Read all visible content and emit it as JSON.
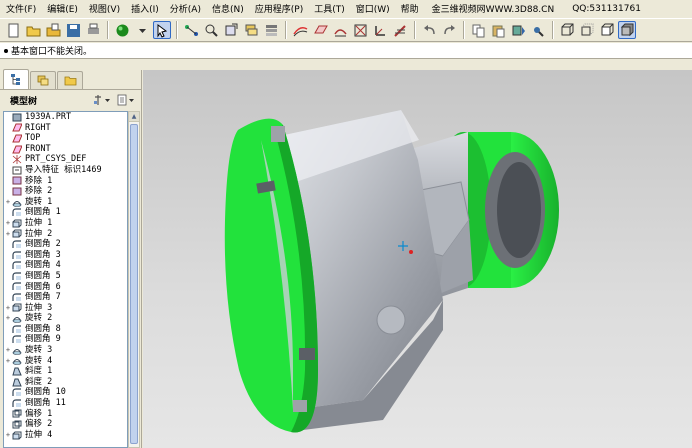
{
  "menubar": {
    "items": [
      "文件(F)",
      "编辑(E)",
      "视图(V)",
      "插入(I)",
      "分析(A)",
      "信息(N)",
      "应用程序(P)",
      "工具(T)",
      "窗口(W)",
      "帮助"
    ],
    "extra_text": "金三维视频网WWW.3D88.CN",
    "qq_text": "QQ:531131761"
  },
  "toolbar": {
    "icons": [
      "new-file-icon",
      "open-folder-icon",
      "open-file-icon",
      "save-icon",
      "print-icon",
      "color-sphere-icon",
      "dropdown-arrow-icon",
      "select-icon",
      "relations-icon",
      "zoom-window-icon",
      "reorient-icon",
      "layers-icon",
      "saved-views-icon",
      "surface-icon",
      "datum-plane-icon",
      "datum-axis-icon",
      "datum-point-icon",
      "coordinate-icon",
      "sketch-icon",
      "undo-icon",
      "redo-icon",
      "copy-icon",
      "paste-icon",
      "regenerate-icon",
      "find-icon",
      "wireframe-icon",
      "hidden-line-icon",
      "no-hidden-icon",
      "shading-icon"
    ]
  },
  "message": "基本窗口不能关闭。",
  "sidebar": {
    "tabs": [
      "model-tree-tab",
      "layers-tab",
      "folder-tab"
    ],
    "tree_title": "模型树",
    "tree": [
      {
        "label": "1939A.PRT",
        "icon": "part",
        "expand": ""
      },
      {
        "label": "RIGHT",
        "icon": "plane",
        "expand": ""
      },
      {
        "label": "TOP",
        "icon": "plane",
        "expand": ""
      },
      {
        "label": "FRONT",
        "icon": "plane",
        "expand": ""
      },
      {
        "label": "PRT_CSYS_DEF",
        "icon": "csys",
        "expand": ""
      },
      {
        "label": "导入特征 标识1469",
        "icon": "import",
        "expand": ""
      },
      {
        "label": "移除 1",
        "icon": "remove",
        "expand": ""
      },
      {
        "label": "移除 2",
        "icon": "remove",
        "expand": ""
      },
      {
        "label": "旋转 1",
        "icon": "revolve",
        "expand": "+"
      },
      {
        "label": "倒圆角 1",
        "icon": "round",
        "expand": ""
      },
      {
        "label": "拉伸 1",
        "icon": "extrude",
        "expand": "+"
      },
      {
        "label": "拉伸 2",
        "icon": "extrude",
        "expand": "+"
      },
      {
        "label": "倒圆角 2",
        "icon": "round",
        "expand": ""
      },
      {
        "label": "倒圆角 3",
        "icon": "round",
        "expand": ""
      },
      {
        "label": "倒圆角 4",
        "icon": "round",
        "expand": ""
      },
      {
        "label": "倒圆角 5",
        "icon": "round",
        "expand": ""
      },
      {
        "label": "倒圆角 6",
        "icon": "round",
        "expand": ""
      },
      {
        "label": "倒圆角 7",
        "icon": "round",
        "expand": ""
      },
      {
        "label": "拉伸 3",
        "icon": "extrude",
        "expand": "+"
      },
      {
        "label": "旋转 2",
        "icon": "revolve",
        "expand": "+"
      },
      {
        "label": "倒圆角 8",
        "icon": "round",
        "expand": ""
      },
      {
        "label": "倒圆角 9",
        "icon": "round",
        "expand": ""
      },
      {
        "label": "旋转 3",
        "icon": "revolve",
        "expand": "+"
      },
      {
        "label": "旋转 4",
        "icon": "revolve",
        "expand": "+"
      },
      {
        "label": "斜度 1",
        "icon": "draft",
        "expand": ""
      },
      {
        "label": "斜度 2",
        "icon": "draft",
        "expand": ""
      },
      {
        "label": "倒圆角 10",
        "icon": "round",
        "expand": ""
      },
      {
        "label": "倒圆角 11",
        "icon": "round",
        "expand": ""
      },
      {
        "label": "偏移 1",
        "icon": "offset",
        "expand": ""
      },
      {
        "label": "偏移 2",
        "icon": "offset",
        "expand": ""
      },
      {
        "label": "拉伸 4",
        "icon": "extrude",
        "expand": "+"
      }
    ]
  },
  "colors": {
    "accent_green": "#22e23c",
    "model_gray": "#b9bcc2",
    "viewport_bg": "#d3d3d3",
    "selection_blue": "#316ac5"
  }
}
